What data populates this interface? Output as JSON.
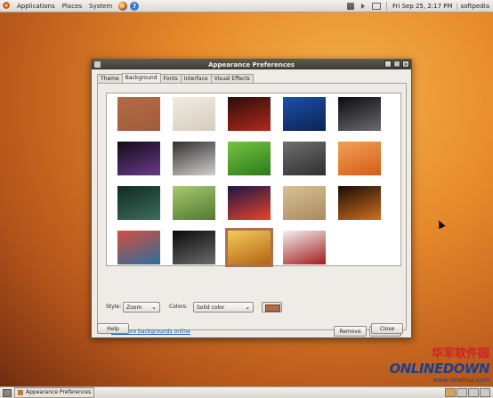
{
  "top_panel": {
    "menus": [
      "Applications",
      "Places",
      "System"
    ],
    "clock": "Fri Sep 25,  2:17 PM",
    "user": "softpedia"
  },
  "window": {
    "title": "Appearance Preferences",
    "tabs": [
      "Theme",
      "Background",
      "Fonts",
      "Interface",
      "Visual Effects"
    ],
    "active_tab": "Background",
    "thumbnails": [
      {
        "name": "solid-brown",
        "colors": [
          "#b36b45",
          "#a05c3a"
        ]
      },
      {
        "name": "hearts",
        "colors": [
          "#f1ebe0",
          "#d7cdbf"
        ]
      },
      {
        "name": "red-berries",
        "colors": [
          "#2a0d0a",
          "#b42a1c"
        ]
      },
      {
        "name": "blue-sky",
        "colors": [
          "#1d4fa8",
          "#0b2355"
        ]
      },
      {
        "name": "galaxy",
        "colors": [
          "#0c0c10",
          "#6b6b70"
        ]
      },
      {
        "name": "lotus",
        "colors": [
          "#120a18",
          "#6a3a8a"
        ]
      },
      {
        "name": "hands",
        "colors": [
          "#303030",
          "#d4d0cc"
        ]
      },
      {
        "name": "green-grass",
        "colors": [
          "#77c343",
          "#2c7a1a"
        ]
      },
      {
        "name": "grey-stone",
        "colors": [
          "#6f6f6f",
          "#2f2f2f"
        ]
      },
      {
        "name": "orange-flower",
        "colors": [
          "#f3a05a",
          "#d45d14"
        ]
      },
      {
        "name": "water-drops",
        "colors": [
          "#0f2a22",
          "#3d6d5b"
        ]
      },
      {
        "name": "green-leaf",
        "colors": [
          "#a8c870",
          "#4f7a2e"
        ]
      },
      {
        "name": "sunset",
        "colors": [
          "#1b1548",
          "#e8442a"
        ]
      },
      {
        "name": "sand-dunes",
        "colors": [
          "#d8c096",
          "#a88b5e"
        ]
      },
      {
        "name": "dark-orange-rays",
        "colors": [
          "#1a0c06",
          "#d0701f"
        ]
      },
      {
        "name": "colored-pencils",
        "colors": [
          "#d44e3d",
          "#2c6e9e"
        ]
      },
      {
        "name": "splash",
        "colors": [
          "#0a0a0a",
          "#6b6b6b"
        ]
      },
      {
        "name": "gold-gradient",
        "colors": [
          "#f4cb5a",
          "#b26213"
        ]
      },
      {
        "name": "tulip",
        "colors": [
          "#f0f0f0",
          "#a51a1a"
        ]
      }
    ],
    "selected_index": 17,
    "style_label": "Style:",
    "style_value": "Zoom",
    "colors_label": "Colors:",
    "colors_value": "Solid color",
    "swatch_color": "#b86a45",
    "link": "Get more backgrounds online",
    "remove": "Remove",
    "add": "Add...",
    "help": "Help",
    "close": "Close"
  },
  "taskbar": {
    "task": "Appearance Preferences"
  },
  "watermark": {
    "line1": "华军软件园",
    "line2": "ONLINEDOWN",
    "line3": "www.newhua.com"
  }
}
